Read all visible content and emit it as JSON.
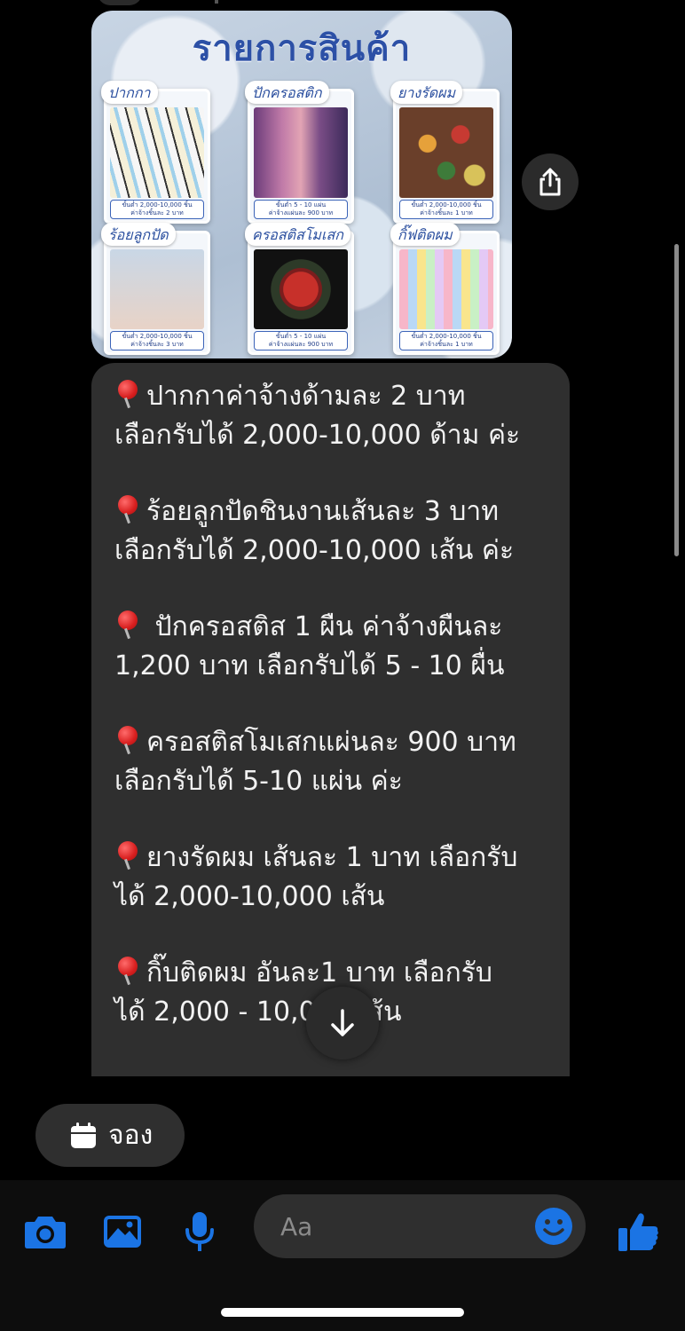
{
  "product_image": {
    "title": "รายการสินค้า",
    "tiles": [
      {
        "label": "ปากกา",
        "caption_1": "ขั้นต่ำ 2,000-10,000 ชิ้น",
        "caption_2": "ค่าจ้างชิ้นละ 2 บาท"
      },
      {
        "label": "ปักครอสติก",
        "caption_1": "ขั้นต่ำ 5 - 10 แผ่น",
        "caption_2": "ค่าจ้างแผ่นละ 900 บาท"
      },
      {
        "label": "ยางรัดผม",
        "caption_1": "ขั้นต่ำ 2,000-10,000 ชิ้น",
        "caption_2": "ค่าจ้างชิ้นละ 1 บาท"
      },
      {
        "label": "ร้อยลูกปัด",
        "caption_1": "ขั้นต่ำ 2,000-10,000 ชิ้น",
        "caption_2": "ค่าจ้างชิ้นละ 3 บาท"
      },
      {
        "label": "ครอสติสโมเสก",
        "caption_1": "ขั้นต่ำ 5 - 10 แผ่น",
        "caption_2": "ค่าจ้างแผ่นละ 900 บาท"
      },
      {
        "label": "กิ๊ฟติดผม",
        "caption_1": "ขั้นต่ำ 2,000-10,000 ชิ้น",
        "caption_2": "ค่าจ้างชิ้นละ 1 บาท"
      }
    ]
  },
  "message": {
    "items": [
      {
        "line1": "ปากกาค่าจ้างด้ามละ 2 บาท",
        "line2": "เลือกรับได้ 2,000-10,000 ด้าม ค่ะ"
      },
      {
        "line1": "ร้อยลูกปัดชินงานเส้นละ 3 บาท",
        "line2": "เลือกรับได้ 2,000-10,000 เส้น ค่ะ"
      },
      {
        "line1": " ปักครอสติส 1 ผืน ค่าจ้างผืนละ",
        "line2": "1,200 บาท เลือกรับได้ 5 - 10 ผื่น"
      },
      {
        "line1": "ครอสติสโมเสกแผ่นละ 900 บาท",
        "line2": "เลือกรับได้ 5-10 แผ่น ค่ะ"
      },
      {
        "line1": "ยางรัดผม เส้นละ 1 บาท เลือกรับ",
        "line2": "ได้ 2,000-10,000 เส้น"
      },
      {
        "line1": "กิ๊บติดผม อันละ1 บาท เลือกรับ",
        "line2": "ได้ 2,000 - 10,000 เส้น"
      }
    ]
  },
  "quick_reply": {
    "label": "จอง",
    "icon": "calendar-icon"
  },
  "composer": {
    "placeholder": "Aa",
    "icons": [
      "camera-icon",
      "image-icon",
      "microphone-icon",
      "emoji-icon",
      "thumbs-up-icon"
    ],
    "accent_color": "#1b74e4"
  },
  "colors": {
    "background": "#000000",
    "bubble": "#2f2f2f",
    "pin": "#d81f1f"
  }
}
